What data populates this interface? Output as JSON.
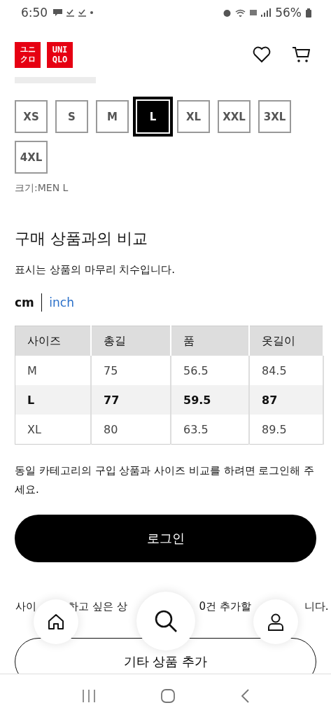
{
  "status_bar": {
    "time": "6:50",
    "battery": "56%"
  },
  "header": {
    "logo_katakana_top": "ユニ",
    "logo_katakana_bottom": "クロ",
    "logo_latin_top": "UNI",
    "logo_latin_bottom": "QLO"
  },
  "sizes": [
    {
      "label": "XS",
      "selected": false
    },
    {
      "label": "S",
      "selected": false
    },
    {
      "label": "M",
      "selected": false
    },
    {
      "label": "L",
      "selected": true
    },
    {
      "label": "XL",
      "selected": false
    },
    {
      "label": "XXL",
      "selected": false
    },
    {
      "label": "3XL",
      "selected": false
    },
    {
      "label": "4XL",
      "selected": false
    }
  ],
  "size_caption": "크기:MEN L",
  "comparison": {
    "title": "구매 상품과의 비교",
    "subtitle": "표시는 상품의 마무리 치수입니다.",
    "units": [
      {
        "label": "cm",
        "selected": true
      },
      {
        "label": "inch",
        "selected": false
      }
    ],
    "table": {
      "columns": [
        "사이즈",
        "총길",
        "품",
        "옷길이"
      ],
      "rows": [
        {
          "cells": [
            "M",
            "75",
            "56.5",
            "84.5"
          ],
          "selected": false
        },
        {
          "cells": [
            "L",
            "77",
            "59.5",
            "87"
          ],
          "selected": true
        },
        {
          "cells": [
            "XL",
            "80",
            "63.5",
            "89.5"
          ],
          "selected": false
        }
      ]
    },
    "login_note": "동일 카테고리의 구입 상품과 사이즈 비교를 하려면 로그인해 주세요.",
    "login_button": "로그인",
    "add_note_fragments": [
      "사이",
      "하고 싶은 상",
      "0건 추가할",
      "니다."
    ],
    "add_button": "기타 상품 추가"
  }
}
